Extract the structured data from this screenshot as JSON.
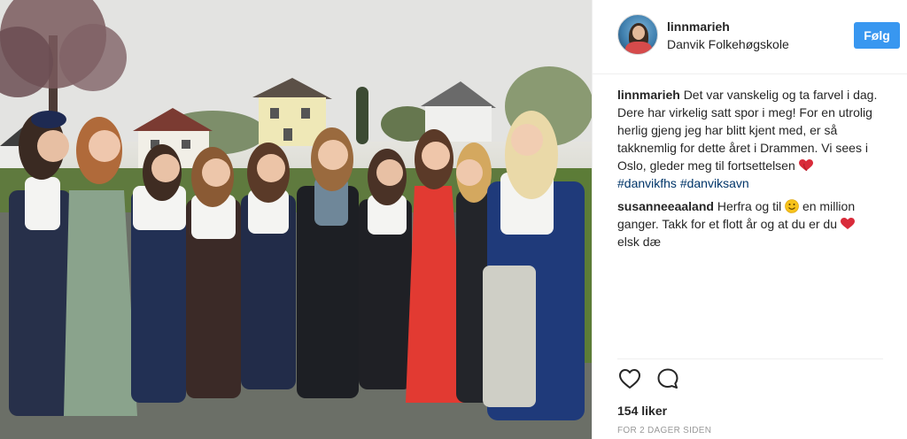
{
  "post": {
    "username": "linnmarieh",
    "location": "Danvik Folkehøgskole",
    "follow_label": "Følg",
    "likes_text": "154 liker",
    "timestamp": "FOR 2 DAGER SIDEN"
  },
  "caption": {
    "user": "linnmarieh",
    "text": "Det var vanskelig og ta farvel i dag. Dere har virkelig satt spor i meg! For en utrolig herlig gjeng jeg har blitt kjent med, er så takknemlig for dette året i Drammen. Vi sees i Oslo, gleder meg til fortsettelsen",
    "emoji": "heart-emoji",
    "hashtags": [
      "#danvikfhs",
      "#danviksavn"
    ]
  },
  "comment": {
    "user": "susanneeaaland",
    "text_before_emoji": "Herfra og til",
    "emoji_1": "smiley-emoji",
    "text_after_emoji": "en million ganger. Takk for et flott år og at du er du",
    "emoji_2": "heart-emoji",
    "text_end": "elsk dæ"
  },
  "icons": {
    "like": "heart-outline-icon",
    "comment": "speech-bubble-icon"
  },
  "colors": {
    "follow_button": "#3897f0",
    "hashtag": "#003569",
    "text": "#262626",
    "muted": "#999999",
    "heart_emoji": "#d92b3a",
    "smiley_emoji": "#f7c21b"
  }
}
